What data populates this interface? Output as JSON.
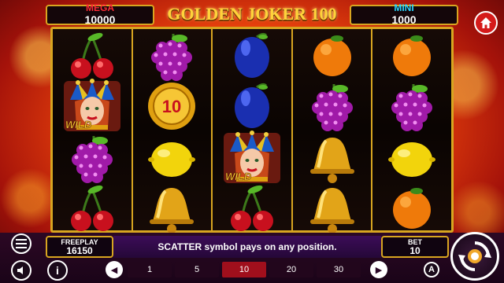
{
  "jackpots": {
    "left": {
      "name": "MEGA",
      "value": "10000",
      "color": "#ff2a36"
    },
    "right": {
      "name": "MINI",
      "value": "1000",
      "color": "#29d6ff"
    }
  },
  "logo": {
    "text": "GOLDEN JOKER 100"
  },
  "reels": [
    [
      "cherries",
      "wild-joker",
      "grapes",
      "cherries"
    ],
    [
      "grapes",
      "coin-10",
      "lemon",
      "bell"
    ],
    [
      "plum",
      "plum",
      "wild-joker",
      "cherries"
    ],
    [
      "orange",
      "grapes",
      "bell",
      "bell"
    ],
    [
      "orange",
      "grapes",
      "lemon",
      "orange"
    ]
  ],
  "symbols": {
    "wild_label": "WILD",
    "coin_value": "10"
  },
  "freeplay": {
    "label": "FREEPLAY",
    "value": "16150"
  },
  "bet": {
    "label": "BET",
    "value": "10"
  },
  "message": "SCATTER symbol pays on any position.",
  "line_options": [
    "1",
    "5",
    "10",
    "20",
    "30"
  ],
  "selected_line_option": "10",
  "buttons": {
    "auto_label": "A",
    "info_label": "i"
  },
  "colors": {
    "gold": "#d8a520",
    "selected": "#a00f1c",
    "home": "#d51a1a"
  }
}
